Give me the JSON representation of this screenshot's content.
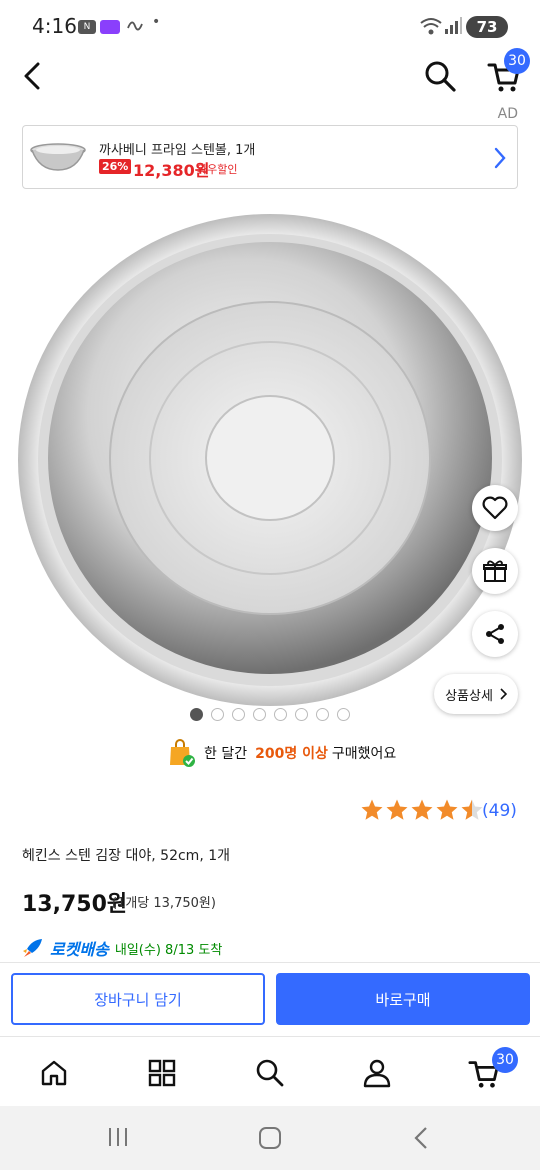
{
  "status_bar": {
    "time": "4:16",
    "battery": "73",
    "dot": "•"
  },
  "header": {
    "cart_count": "30",
    "ad_label": "AD"
  },
  "ad_banner": {
    "title": "까사베니 프라임 스텐볼, 1개",
    "discount": "26%",
    "price": "12,380원",
    "wow_label": "와우할인"
  },
  "product": {
    "detail_button": "상품상세",
    "purchase_note_prefix": "한 달간",
    "purchase_note_highlight": "200명 이상",
    "purchase_note_suffix": "구매했어요",
    "rating": 4.5,
    "review_count": "(49)",
    "name": "헤킨스 스텐 김장 대야, 52cm, 1개",
    "price": "13,750원",
    "unit_price": "(1개당 13,750원)",
    "rocket_label": "로켓배송",
    "arrival": "내일(수) 8/13 도착"
  },
  "image_carousel": {
    "total_images": 8,
    "active_index": 0
  },
  "actions": {
    "add_to_cart": "장바구니 담기",
    "buy_now": "바로구매"
  },
  "bottom_nav": {
    "cart_count": "30"
  },
  "colors": {
    "accent_blue": "#346aff",
    "sale_red": "#e52528",
    "orange": "#e8590c",
    "star": "#f28b2a"
  }
}
